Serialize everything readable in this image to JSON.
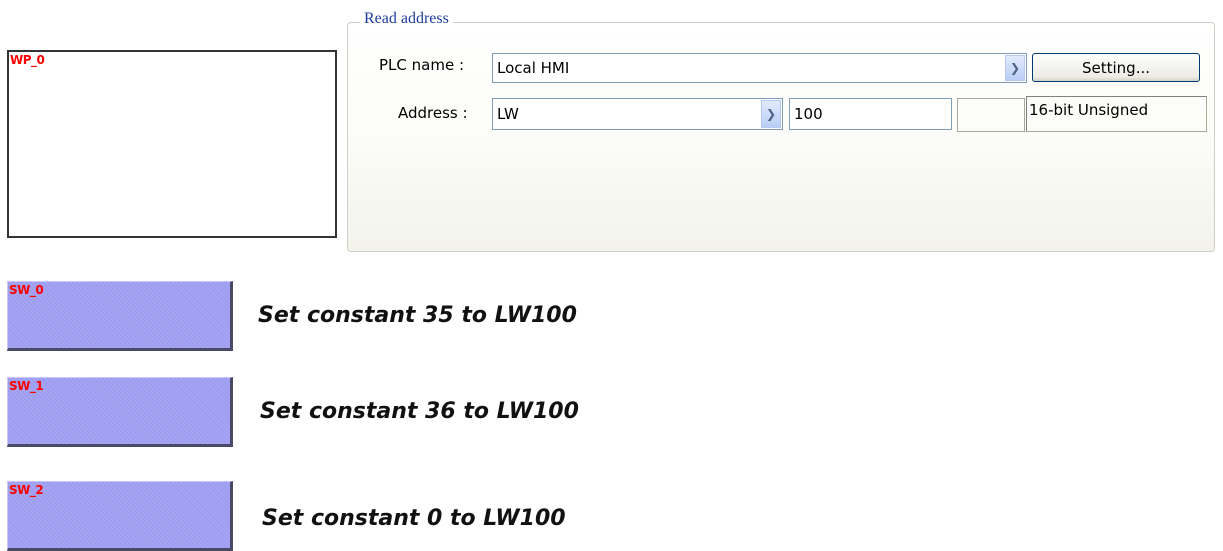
{
  "window_part": {
    "label": "WP_0"
  },
  "read_address": {
    "title": "Read address",
    "plc_name_label": "PLC name :",
    "plc_name_value": "Local HMI",
    "setting_button": "Setting...",
    "address_label": "Address :",
    "address_device": "LW",
    "address_number": "100",
    "data_format": "16-bit Unsigned"
  },
  "switches": [
    {
      "label": "SW_0",
      "caption": "Set constant 35 to LW100"
    },
    {
      "label": "SW_1",
      "caption": "Set constant 36 to LW100"
    },
    {
      "label": "SW_2",
      "caption": "Set constant 0 to LW100"
    }
  ],
  "colors": {
    "switch_fill": "#9c9cf0",
    "object_label": "#ff0000",
    "group_title": "#1e3e9e"
  }
}
